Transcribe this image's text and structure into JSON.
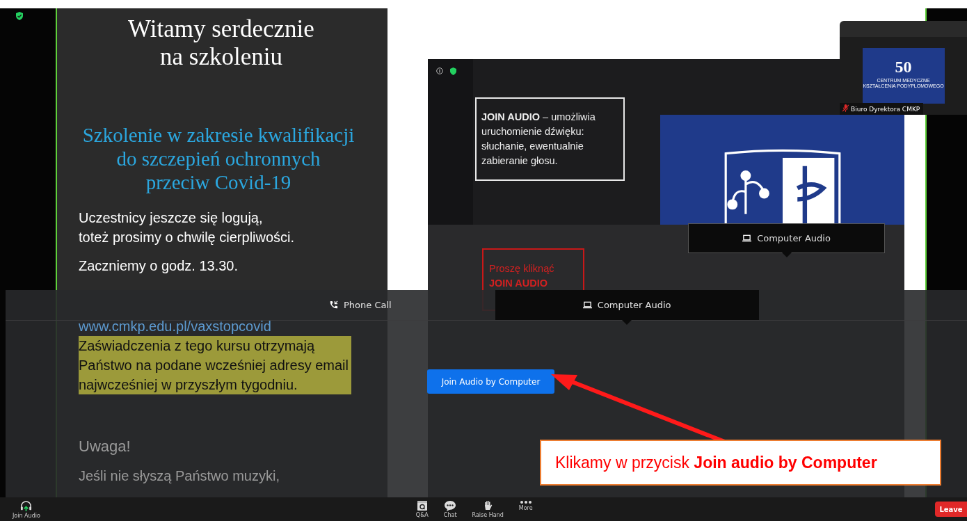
{
  "slide": {
    "title": [
      "Witamy serdecznie",
      "na szkoleniu"
    ],
    "subtitle": [
      "Szkolenie w zakresie kwalifikacji",
      "do szczepień ochronnych",
      "przeciw Covid-19"
    ],
    "info": [
      "Uczestnicy jeszcze się logują,",
      "toteż prosimy o chwilę cierpliwości."
    ],
    "start_time": "Zaczniemy o godz. 13.30.",
    "link": "www.cmkp.edu.pl/vaxstopcovid",
    "highlighted": [
      "Zaświadczenia z tego kursu otrzymają",
      "Państwo na podane wcześniej adresy email",
      "najwcześniej w przyszłym tygodniu."
    ],
    "warning_heading": "Uwaga!",
    "warning_text": "Jeśli nie słyszą Państwo muzyki,"
  },
  "shared_screen": {
    "text_box": [
      "**JOIN AUDIO** – umożliwia",
      "uruchomienie dźwięku:",
      "słuchanie,  ewentualnie",
      "zabieranie głosu."
    ],
    "red_box": [
      "Proszę kliknąć",
      "**JOIN AUDIO**"
    ],
    "tabs": [
      {
        "label": "Computer Audio",
        "selected": true
      }
    ]
  },
  "video_tile": {
    "logo_number": "50",
    "logo_caption": [
      "CENTRUM MEDYCZNE",
      "KSZTAŁCENIA PODYPLOMOWEGO"
    ],
    "name": "Biuro Dyrektora CMKP",
    "muted": true
  },
  "audio_dialog": {
    "tabs": [
      {
        "label": "Phone Call",
        "kind": "phone",
        "selected": false
      },
      {
        "label": "Computer Audio",
        "kind": "computer",
        "selected": true
      }
    ],
    "join_button": "Join Audio by Computer"
  },
  "callout": {
    "text": "Klikamy w przycisk **Join audio by Computer**"
  },
  "toolbar": {
    "join_audio": "Join Audio",
    "items": [
      {
        "label": "Q&A",
        "kind": "qa"
      },
      {
        "label": "Chat",
        "kind": "chat"
      },
      {
        "label": "Raise Hand",
        "kind": "hand"
      },
      {
        "label": "More",
        "kind": "more"
      }
    ],
    "leave": "Leave"
  }
}
